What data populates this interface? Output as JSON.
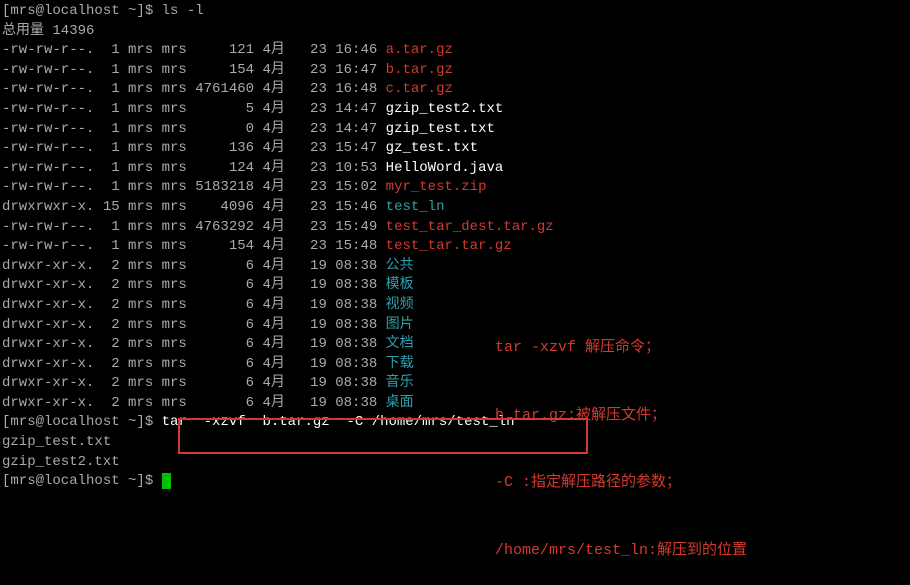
{
  "lines": {
    "pre_prompt": "[mrs@localhost ~]$ ls -l",
    "total": "总用量 14396",
    "rows": [
      {
        "perm": "-rw-rw-r--.",
        "ln": " 1",
        "u": "mrs",
        "g": "mrs",
        "size": "    121",
        "m": "4月",
        "d": "  23",
        "t": "16:46",
        "name": "a.tar.gz",
        "cls": "red"
      },
      {
        "perm": "-rw-rw-r--.",
        "ln": " 1",
        "u": "mrs",
        "g": "mrs",
        "size": "    154",
        "m": "4月",
        "d": "  23",
        "t": "16:47",
        "name": "b.tar.gz",
        "cls": "red"
      },
      {
        "perm": "-rw-rw-r--.",
        "ln": " 1",
        "u": "mrs",
        "g": "mrs",
        "size": "4761460",
        "m": "4月",
        "d": "  23",
        "t": "16:48",
        "name": "c.tar.gz",
        "cls": "red"
      },
      {
        "perm": "-rw-rw-r--.",
        "ln": " 1",
        "u": "mrs",
        "g": "mrs",
        "size": "      5",
        "m": "4月",
        "d": "  23",
        "t": "14:47",
        "name": "gzip_test2.txt",
        "cls": "white"
      },
      {
        "perm": "-rw-rw-r--.",
        "ln": " 1",
        "u": "mrs",
        "g": "mrs",
        "size": "      0",
        "m": "4月",
        "d": "  23",
        "t": "14:47",
        "name": "gzip_test.txt",
        "cls": "white"
      },
      {
        "perm": "-rw-rw-r--.",
        "ln": " 1",
        "u": "mrs",
        "g": "mrs",
        "size": "    136",
        "m": "4月",
        "d": "  23",
        "t": "15:47",
        "name": "gz_test.txt",
        "cls": "white"
      },
      {
        "perm": "-rw-rw-r--.",
        "ln": " 1",
        "u": "mrs",
        "g": "mrs",
        "size": "    124",
        "m": "4月",
        "d": "  23",
        "t": "10:53",
        "name": "HelloWord.java",
        "cls": "white"
      },
      {
        "perm": "-rw-rw-r--.",
        "ln": " 1",
        "u": "mrs",
        "g": "mrs",
        "size": "5183218",
        "m": "4月",
        "d": "  23",
        "t": "15:02",
        "name": "myr_test.zip",
        "cls": "red"
      },
      {
        "perm": "drwxrwxr-x.",
        "ln": "15",
        "u": "mrs",
        "g": "mrs",
        "size": "   4096",
        "m": "4月",
        "d": "  23",
        "t": "15:46",
        "name": "test_ln",
        "cls": "cyan"
      },
      {
        "perm": "-rw-rw-r--.",
        "ln": " 1",
        "u": "mrs",
        "g": "mrs",
        "size": "4763292",
        "m": "4月",
        "d": "  23",
        "t": "15:49",
        "name": "test_tar_dest.tar.gz",
        "cls": "red"
      },
      {
        "perm": "-rw-rw-r--.",
        "ln": " 1",
        "u": "mrs",
        "g": "mrs",
        "size": "    154",
        "m": "4月",
        "d": "  23",
        "t": "15:48",
        "name": "test_tar.tar.gz",
        "cls": "red"
      },
      {
        "perm": "drwxr-xr-x.",
        "ln": " 2",
        "u": "mrs",
        "g": "mrs",
        "size": "      6",
        "m": "4月",
        "d": "  19",
        "t": "08:38",
        "name": "公共",
        "cls": "cyan"
      },
      {
        "perm": "drwxr-xr-x.",
        "ln": " 2",
        "u": "mrs",
        "g": "mrs",
        "size": "      6",
        "m": "4月",
        "d": "  19",
        "t": "08:38",
        "name": "模板",
        "cls": "cyan"
      },
      {
        "perm": "drwxr-xr-x.",
        "ln": " 2",
        "u": "mrs",
        "g": "mrs",
        "size": "      6",
        "m": "4月",
        "d": "  19",
        "t": "08:38",
        "name": "视频",
        "cls": "cyan"
      },
      {
        "perm": "drwxr-xr-x.",
        "ln": " 2",
        "u": "mrs",
        "g": "mrs",
        "size": "      6",
        "m": "4月",
        "d": "  19",
        "t": "08:38",
        "name": "图片",
        "cls": "cyan"
      },
      {
        "perm": "drwxr-xr-x.",
        "ln": " 2",
        "u": "mrs",
        "g": "mrs",
        "size": "      6",
        "m": "4月",
        "d": "  19",
        "t": "08:38",
        "name": "文档",
        "cls": "cyan"
      },
      {
        "perm": "drwxr-xr-x.",
        "ln": " 2",
        "u": "mrs",
        "g": "mrs",
        "size": "      6",
        "m": "4月",
        "d": "  19",
        "t": "08:38",
        "name": "下载",
        "cls": "cyan"
      },
      {
        "perm": "drwxr-xr-x.",
        "ln": " 2",
        "u": "mrs",
        "g": "mrs",
        "size": "      6",
        "m": "4月",
        "d": "  19",
        "t": "08:38",
        "name": "音乐",
        "cls": "cyan"
      },
      {
        "perm": "drwxr-xr-x.",
        "ln": " 2",
        "u": "mrs",
        "g": "mrs",
        "size": "      6",
        "m": "4月",
        "d": "  19",
        "t": "08:38",
        "name": "桌面",
        "cls": "cyan"
      }
    ],
    "tarcmd_prompt": "[mrs@localhost ~]$ ",
    "tarcmd": "tar  -xzvf  b.tar.gz  -C /home/mrs/test_ln",
    "out1": "gzip_test.txt",
    "out2": "gzip_test2.txt",
    "final_prompt": "[mrs@localhost ~]$ "
  },
  "annotation": {
    "l1": "tar -xzvf 解压命令；",
    "l2": "b.tar.gz:被解压文件；",
    "l3": "-C :指定解压路径的参数；",
    "l4": "/home/mrs/test_ln:解压到的位置"
  }
}
